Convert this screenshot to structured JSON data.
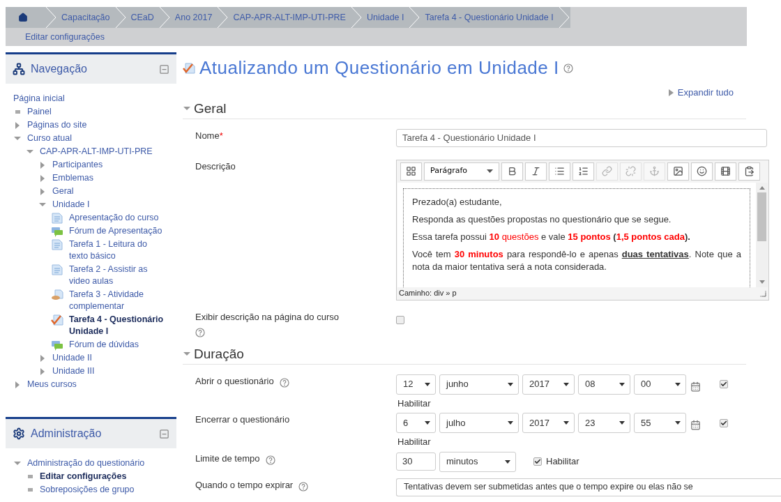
{
  "breadcrumb": [
    {
      "label": "Capacitação"
    },
    {
      "label": "CEaD"
    },
    {
      "label": "Ano 2017"
    },
    {
      "label": "CAP-APR-ALT-IMP-UTI-PRE"
    },
    {
      "label": "Unidade I"
    },
    {
      "label": "Tarefa 4 - Questionário Unidade I"
    }
  ],
  "action_bar": {
    "label": "Editar configurações"
  },
  "navigation": {
    "title": "Navegação",
    "items": [
      {
        "label": "Página inicial",
        "kind": "root",
        "selected": false
      },
      {
        "label": "Painel",
        "kind": "bullet",
        "selected": false
      },
      {
        "label": "Páginas do site",
        "kind": "branch",
        "expanded": false,
        "selected": false
      },
      {
        "label": "Curso atual",
        "kind": "branch",
        "expanded": true,
        "selected": false,
        "children": [
          {
            "label": "CAP-APR-ALT-IMP-UTI-PRE",
            "kind": "branch",
            "expanded": true,
            "selected": false,
            "children": [
              {
                "label": "Participantes",
                "kind": "branch",
                "expanded": false,
                "selected": false
              },
              {
                "label": "Emblemas",
                "kind": "branch",
                "expanded": false,
                "selected": false
              },
              {
                "label": "Geral",
                "kind": "branch",
                "expanded": false,
                "selected": false
              },
              {
                "label": "Unidade I",
                "kind": "branch",
                "expanded": true,
                "selected": false,
                "children": [
                  {
                    "label": "Apresentação do curso",
                    "kind": "page",
                    "selected": false
                  },
                  {
                    "label": "Fórum de Apresentação",
                    "kind": "forum",
                    "selected": false
                  },
                  {
                    "label": "Tarefa 1 - Leitura do texto básico",
                    "kind": "page",
                    "selected": false
                  },
                  {
                    "label": "Tarefa 2 - Assistir as video aulas",
                    "kind": "page",
                    "selected": false
                  },
                  {
                    "label": "Tarefa 3 - Atividade complementar",
                    "kind": "assign",
                    "selected": false
                  },
                  {
                    "label": "Tarefa 4 - Questionário Unidade I",
                    "kind": "quiz",
                    "selected": true
                  },
                  {
                    "label": "Fórum de dúvidas",
                    "kind": "forum",
                    "selected": false
                  }
                ]
              },
              {
                "label": "Unidade II",
                "kind": "branch",
                "expanded": false,
                "selected": false
              },
              {
                "label": "Unidade III",
                "kind": "branch",
                "expanded": false,
                "selected": false
              }
            ]
          }
        ]
      },
      {
        "label": "Meus cursos",
        "kind": "branch",
        "expanded": false,
        "selected": false
      }
    ]
  },
  "administration": {
    "title": "Administração",
    "items": [
      {
        "label": "Administração do questionário",
        "kind": "branch",
        "expanded": true,
        "selected": false,
        "children": [
          {
            "label": "Editar configurações",
            "kind": "bullet",
            "selected": true
          },
          {
            "label": "Sobreposições de grupo",
            "kind": "bullet",
            "selected": false
          }
        ]
      }
    ]
  },
  "page_title": "Atualizando um Questionário em Unidade I",
  "expand_all": "Expandir tudo",
  "sections": [
    {
      "title": "Geral",
      "expanded": true,
      "fields": [
        {
          "kind": "text",
          "label": "Nome",
          "required_mark": "*",
          "help": false,
          "value": "Tarefa 4 - Questionário Unidade I"
        },
        {
          "kind": "editor",
          "label": "Descrição",
          "help": false,
          "format": "Parágrafo",
          "tools": [
            {
              "kind": "toggle",
              "disabled": false
            },
            {
              "kind": "bold",
              "disabled": false
            },
            {
              "kind": "italic",
              "disabled": false
            },
            {
              "kind": "bullets",
              "disabled": false
            },
            {
              "kind": "numbers",
              "disabled": false
            },
            {
              "kind": "link",
              "disabled": true
            },
            {
              "kind": "unlink",
              "disabled": true
            },
            {
              "kind": "anchor",
              "disabled": true
            },
            {
              "kind": "image",
              "disabled": false
            },
            {
              "kind": "emoticon",
              "disabled": false
            },
            {
              "kind": "media",
              "disabled": false
            },
            {
              "kind": "paste",
              "disabled": false
            }
          ],
          "paragraphs": [
            [
              {
                "text": "Prezado(a) estudante,",
                "kind": "plain"
              }
            ],
            [
              {
                "text": "Responda as questões propostas no questionário que se segue.",
                "kind": "plain"
              }
            ],
            [
              {
                "text": "Essa tarefa possui ",
                "kind": "plain"
              },
              {
                "text": "10",
                "kind": "red_bold"
              },
              {
                "text": " questões",
                "kind": "red"
              },
              {
                "text": " e vale ",
                "kind": "plain"
              },
              {
                "text": "15 pontos",
                "kind": "red_bold"
              },
              {
                "text": " (",
                "kind": "bold"
              },
              {
                "text": "1,5 pontos cada",
                "kind": "red_bold"
              },
              {
                "text": ").",
                "kind": "bold"
              }
            ],
            [
              {
                "text": "Você tem ",
                "kind": "plain"
              },
              {
                "text": "30 minutos",
                "kind": "red_bold"
              },
              {
                "text": " para respondê-lo e apenas ",
                "kind": "plain"
              },
              {
                "text": "duas tentativas",
                "kind": "bold_underline"
              },
              {
                "text": ". Note que a nota da maior tentativa será a nota considerada.",
                "kind": "plain"
              }
            ]
          ],
          "path": "Caminho: div » p"
        },
        {
          "kind": "checkbox",
          "label": "Exibir descrição na página do curso",
          "help": true,
          "checked": false
        }
      ]
    },
    {
      "title": "Duração",
      "expanded": true,
      "fields": [
        {
          "kind": "datetime",
          "label": "Abrir o questionário",
          "help": true,
          "parts": [
            {
              "value": "12"
            },
            {
              "value": "junho"
            },
            {
              "value": "2017"
            },
            {
              "value": "08"
            },
            {
              "value": "00"
            }
          ],
          "enabled": true,
          "enable_label": "Habilitar"
        },
        {
          "kind": "datetime",
          "label": "Encerrar o questionário",
          "help": false,
          "parts": [
            {
              "value": "6"
            },
            {
              "value": "julho"
            },
            {
              "value": "2017"
            },
            {
              "value": "23"
            },
            {
              "value": "55"
            }
          ],
          "enabled": true,
          "enable_label": "Habilitar"
        },
        {
          "kind": "duration",
          "label": "Limite de tempo",
          "help": true,
          "value": "30",
          "unit": "minutos",
          "enabled": true,
          "enable_label": "Habilitar"
        },
        {
          "kind": "select",
          "label": "Quando o tempo expirar",
          "help": true,
          "value": "Tentativas devem ser submetidas antes que o tempo expire ou elas não se"
        }
      ]
    }
  ]
}
